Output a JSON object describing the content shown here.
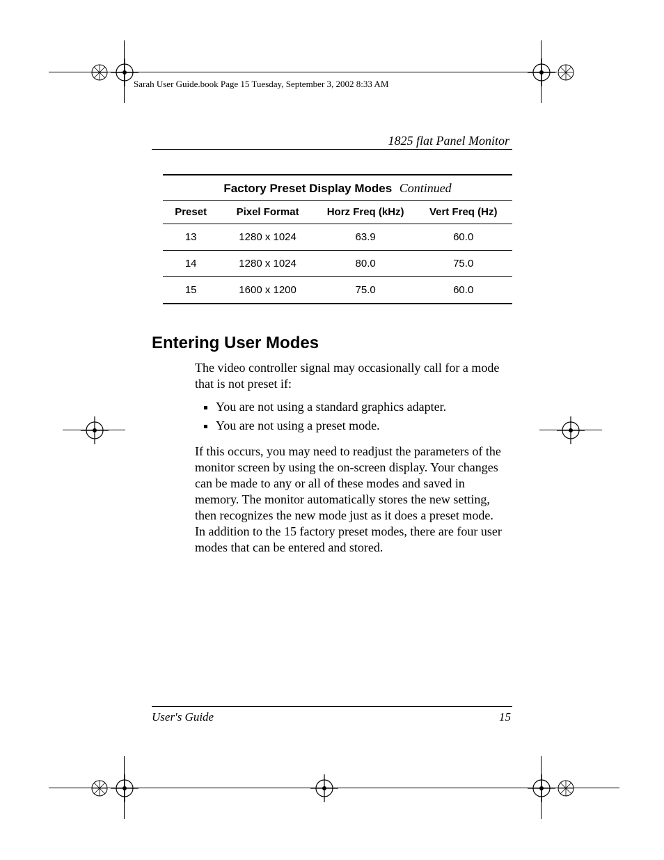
{
  "crop_header": "Sarah User Guide.book  Page 15  Tuesday, September 3, 2002  8:33 AM",
  "running_head": "1825 flat Panel Monitor",
  "table": {
    "title_bold": "Factory Preset Display Modes",
    "title_ital": "Continued",
    "headers": {
      "preset": "Preset",
      "pixel": "Pixel Format",
      "horz": "Horz Freq (kHz)",
      "vert": "Vert Freq (Hz)"
    },
    "rows": [
      {
        "preset": "13",
        "pixel": "1280 x 1024",
        "horz": "63.9",
        "vert": "60.0"
      },
      {
        "preset": "14",
        "pixel": "1280 x 1024",
        "horz": "80.0",
        "vert": "75.0"
      },
      {
        "preset": "15",
        "pixel": "1600 x 1200",
        "horz": "75.0",
        "vert": "60.0"
      }
    ]
  },
  "section_heading": "Entering User Modes",
  "body": {
    "p1": "The video controller signal may occasionally call for a mode that is not preset if:",
    "bullets": [
      "You are not using a standard graphics adapter.",
      "You are not using a preset mode."
    ],
    "p2": "If this occurs, you may need to readjust the parameters of the monitor screen by using the on-screen display. Your changes can be made to any or all of these modes and saved in memory. The monitor automatically stores the new setting, then recognizes the new mode just as it does a preset mode. In addition to the 15 factory preset modes, there are four user modes that can be entered and stored."
  },
  "footer": {
    "left": "User's Guide",
    "right": "15"
  }
}
